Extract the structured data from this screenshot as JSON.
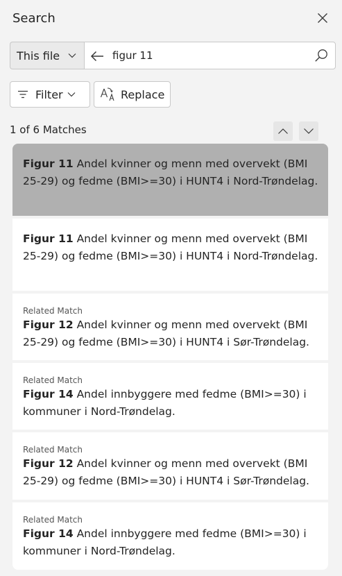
{
  "header": {
    "title": "Search",
    "close_icon": "close-icon"
  },
  "search": {
    "scope": "This file",
    "query": "figur 11",
    "back_icon": "arrow-left-icon",
    "search_icon": "search-icon"
  },
  "toolbar": {
    "filter_label": "Filter",
    "replace_label": "Replace"
  },
  "matches": {
    "summary": "1 of 6 Matches"
  },
  "results": [
    {
      "tag": "",
      "figure": "Figur 11",
      "text": " Andel kvinner og menn med overvekt (BMI 25-29) og fedme (BMI>=30) i HUNT4 i Nord-Trøndelag.",
      "selected": true
    },
    {
      "tag": "",
      "figure": "Figur 11",
      "text": " Andel kvinner og menn med overvekt (BMI 25-29) og fedme (BMI>=30) i HUNT4 i Nord-Trøndelag.",
      "selected": false
    },
    {
      "tag": "Related Match",
      "figure": "Figur 12",
      "text": " Andel kvinner og menn med overvekt (BMI 25-29) og fedme (BMI>=30) i HUNT4 i Sør-Trøndelag.",
      "selected": false
    },
    {
      "tag": "Related Match",
      "figure": "Figur 14",
      "text": " Andel innbyggere med fedme (BMI>=30) i kommuner i Nord-Trøndelag.",
      "selected": false
    },
    {
      "tag": "Related Match",
      "figure": "Figur 12",
      "text": " Andel kvinner og menn med overvekt (BMI 25-29) og fedme (BMI>=30) i HUNT4 i Sør-Trøndelag.",
      "selected": false
    },
    {
      "tag": "Related Match",
      "figure": "Figur 14",
      "text": " Andel innbyggere med fedme (BMI>=30) i kommuner i Nord-Trøndelag.",
      "selected": false
    }
  ],
  "colors": {
    "panel_bg": "#f3f3f3",
    "selected_bg": "#b0b0b0",
    "card_bg": "#ffffff"
  }
}
